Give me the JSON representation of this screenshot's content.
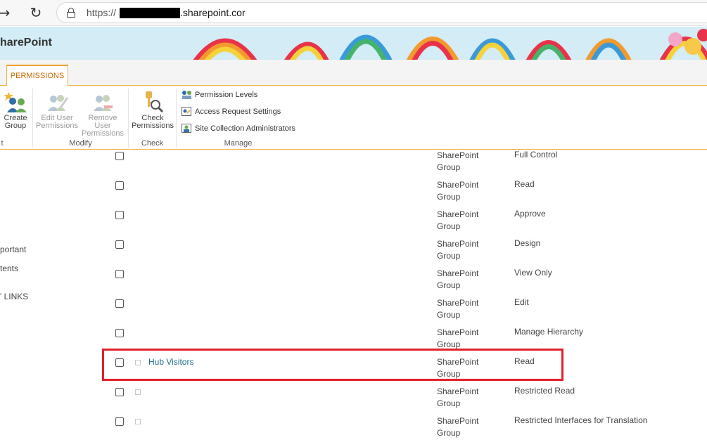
{
  "browser": {
    "url_prefix": "https://",
    "url_host": ".sharepoint.cor"
  },
  "banner": {
    "brand": "harePoint"
  },
  "ribbon": {
    "tab_label": "PERMISSIONS",
    "buttons": {
      "create_group_line1": "Create",
      "create_group_line2": "Group",
      "edit_user_line1": "Edit User",
      "edit_user_line2": "Permissions",
      "remove_user_line1": "Remove User",
      "remove_user_line2": "Permissions",
      "check_line1": "Check",
      "check_line2": "Permissions",
      "permission_levels": "Permission Levels",
      "access_request": "Access Request Settings",
      "site_collection_admins": "Site Collection Administrators"
    },
    "groups": {
      "grant_fragment": "t",
      "modify": "Modify",
      "check": "Check",
      "manage": "Manage"
    }
  },
  "leftnav": {
    "item1": "portant",
    "item2": "tents",
    "item3": "' LINKS"
  },
  "rows": [
    {
      "name": "",
      "type_line1": "SharePoint",
      "type_line2": "Group",
      "level": "Full Control"
    },
    {
      "name": "",
      "type_line1": "SharePoint",
      "type_line2": "Group",
      "level": "Read"
    },
    {
      "name": "",
      "type_line1": "SharePoint",
      "type_line2": "Group",
      "level": "Approve"
    },
    {
      "name": "",
      "type_line1": "SharePoint",
      "type_line2": "Group",
      "level": "Design"
    },
    {
      "name": "",
      "type_line1": "SharePoint",
      "type_line2": "Group",
      "level": "View Only"
    },
    {
      "name": "",
      "type_line1": "SharePoint",
      "type_line2": "Group",
      "level": "Edit"
    },
    {
      "name": "",
      "type_line1": "SharePoint",
      "type_line2": "Group",
      "level": "Manage Hierarchy"
    },
    {
      "name": "Hub Visitors",
      "type_line1": "SharePoint",
      "type_line2": "Group",
      "level": "Read"
    },
    {
      "name": "",
      "type_line1": "SharePoint",
      "type_line2": "Group",
      "level": "Restricted Read"
    },
    {
      "name": "",
      "type_line1": "SharePoint",
      "type_line2": "Group",
      "level": "Restricted Interfaces for Translation"
    }
  ],
  "colors": {
    "accent": "#f0a030",
    "link": "#1e6c8c",
    "highlight": "#e0202a"
  }
}
